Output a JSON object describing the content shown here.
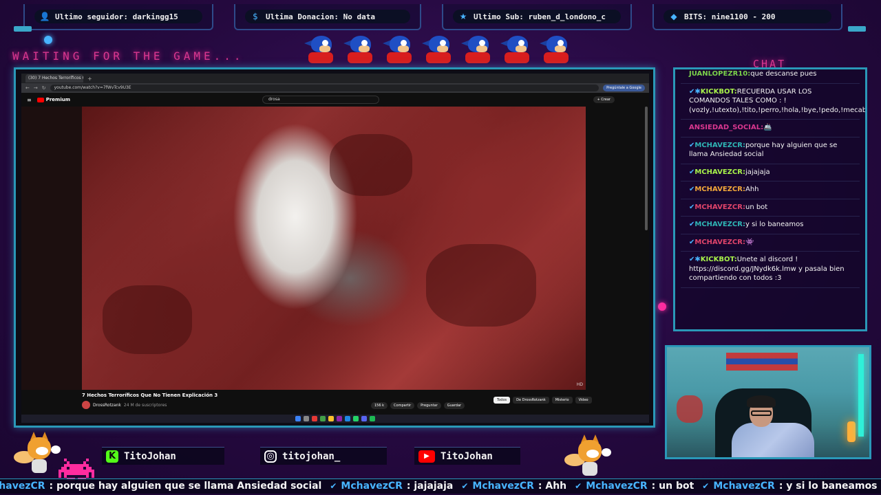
{
  "top_bars": [
    {
      "icon": "user-icon",
      "text": "Ultimo seguidor: darkingg15"
    },
    {
      "icon": "dollar-icon",
      "text": "Ultima Donacion: No data"
    },
    {
      "icon": "star-icon",
      "text": "Ultimo Sub: ruben_d_londono_c"
    },
    {
      "icon": "diamond-icon",
      "text": "BITS: nine1100 - 200"
    }
  ],
  "waiting_text": "WAITING FOR THE GAME...",
  "chat_title": "CHAT",
  "browser": {
    "tab_title": "(30) 7 Hechos Terroríficos Q...",
    "url": "youtube.com/watch?v=7fWvTcv9U3E",
    "google_btn": "Pregúntale a Google",
    "yt_brand": "Premium",
    "search_value": "drosa",
    "crear_label": "+ Crear",
    "video_title": "7 Hechos Terroríficos Que No Tienen Explicación 3",
    "channel_name": "DrossRotzank",
    "channel_subs": "24 M de suscriptores",
    "actions": [
      "156 k",
      "Compartir",
      "Preguntar",
      "Guardar"
    ],
    "chips": [
      "Todos",
      "De DrossRotzank",
      "Misterio",
      "Video"
    ],
    "hd_label": "HD"
  },
  "chat": [
    {
      "user": "JUANLOPEZR10",
      "user_color": "#7ad04a",
      "badge": "",
      "text": "que descanse pues"
    },
    {
      "user": "KICKBOT",
      "user_color": "#a8f24a",
      "badge": "✔✱",
      "text": "RECUERDA USAR LOS COMANDOS TALES COMO : !(vozly,!utexto),!tito,!perro,!hola,!bye,!pedo,!mecabe,!manco,!cuernos,!facha,!memide,!maldad,!lis,!chupi,!clip)"
    },
    {
      "user": "ANSIEDAD_SOCIAL",
      "user_color": "#d9378f",
      "badge": "",
      "text": "🚢"
    },
    {
      "user": "MCHAVEZCR",
      "user_color": "#2fb5b5",
      "badge": "✔",
      "text": "porque hay alguien que se llama Ansiedad social"
    },
    {
      "user": "MCHAVEZCR",
      "user_color": "#a8f24a",
      "badge": "✔",
      "text": "jajajaja"
    },
    {
      "user": "MCHAVEZCR",
      "user_color": "#f2a83a",
      "badge": "✔",
      "text": "Ahh"
    },
    {
      "user": "MCHAVEZCR",
      "user_color": "#e0446a",
      "badge": "✔",
      "text": "un bot"
    },
    {
      "user": "MCHAVEZCR",
      "user_color": "#2fb5b5",
      "badge": "✔",
      "text": "y si lo baneamos"
    },
    {
      "user": "MCHAVEZCR",
      "user_color": "#e0446a",
      "badge": "✔",
      "text": "👾"
    },
    {
      "user": "KICKBOT",
      "user_color": "#a8f24a",
      "badge": "✔✱",
      "text": "Unete al discord ! https://discord.gg/JNydk6k.lmw y pasala bien compartiendo con todos :3"
    }
  ],
  "socials": [
    {
      "icon": "kick-icon",
      "glyph": "K",
      "color": "#53fc18",
      "text": "TitoJohan"
    },
    {
      "icon": "instagram-icon",
      "glyph": "◎",
      "color": "#e1306c",
      "text": "titojohan_"
    },
    {
      "icon": "youtube-icon",
      "glyph": "▶",
      "color": "#ff0000",
      "text": "TitoJohan"
    }
  ],
  "ticker": [
    {
      "user": "MchavezCR",
      "text": ": porque hay alguien que se llama Ansiedad social"
    },
    {
      "user": "MchavezCR",
      "text": ": jajajaja"
    },
    {
      "user": "MchavezCR",
      "text": ": Ahh"
    },
    {
      "user": "MchavezCR",
      "text": ": un bot"
    },
    {
      "user": "MchavezCR",
      "text": ": y si lo baneamos"
    },
    {
      "user": "MchavezCR",
      "text": ":"
    }
  ],
  "colors": {
    "accent_pink": "#d9378f",
    "frame_cyan": "#2a98b8",
    "ticker_blue": "#48b4ff"
  }
}
